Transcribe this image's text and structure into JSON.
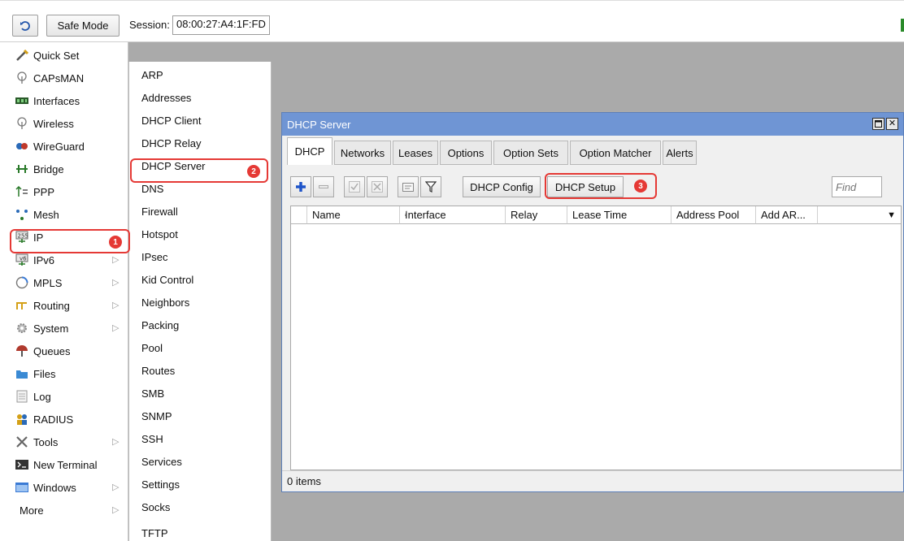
{
  "toolbar": {
    "safe_mode_label": "Safe Mode",
    "session_label": "Session:",
    "session_value": "08:00:27:A4:1F:FD"
  },
  "menu": {
    "items": [
      {
        "label": "Quick Set",
        "icon": "wand-icon"
      },
      {
        "label": "CAPsMAN",
        "icon": "antenna-icon"
      },
      {
        "label": "Interfaces",
        "icon": "interfaces-icon"
      },
      {
        "label": "Wireless",
        "icon": "wireless-icon"
      },
      {
        "label": "WireGuard",
        "icon": "wireguard-icon"
      },
      {
        "label": "Bridge",
        "icon": "bridge-icon"
      },
      {
        "label": "PPP",
        "icon": "ppp-icon"
      },
      {
        "label": "Mesh",
        "icon": "mesh-icon"
      },
      {
        "label": "IP",
        "icon": "ip-icon"
      },
      {
        "label": "IPv6",
        "icon": "ipv6-icon"
      },
      {
        "label": "MPLS",
        "icon": "mpls-icon"
      },
      {
        "label": "Routing",
        "icon": "routing-icon"
      },
      {
        "label": "System",
        "icon": "system-icon"
      },
      {
        "label": "Queues",
        "icon": "queues-icon"
      },
      {
        "label": "Files",
        "icon": "files-icon"
      },
      {
        "label": "Log",
        "icon": "log-icon"
      },
      {
        "label": "RADIUS",
        "icon": "radius-icon"
      },
      {
        "label": "Tools",
        "icon": "tools-icon"
      },
      {
        "label": "New Terminal",
        "icon": "terminal-icon"
      },
      {
        "label": "Windows",
        "icon": "windows-icon"
      },
      {
        "label": "More",
        "icon": ""
      }
    ]
  },
  "submenu": {
    "items": [
      "ARP",
      "Addresses",
      "DHCP Client",
      "DHCP Relay",
      "DHCP Server",
      "DNS",
      "Firewall",
      "Hotspot",
      "IPsec",
      "Kid Control",
      "Neighbors",
      "Packing",
      "Pool",
      "Routes",
      "SMB",
      "SNMP",
      "SSH",
      "Services",
      "Settings",
      "Socks",
      "TFTP"
    ]
  },
  "annotations": {
    "step1": "1",
    "step2": "2",
    "step3": "3"
  },
  "window": {
    "title": "DHCP Server",
    "tabs": [
      "DHCP",
      "Networks",
      "Leases",
      "Options",
      "Option Sets",
      "Option Matcher",
      "Alerts"
    ],
    "buttons": {
      "dhcp_config": "DHCP Config",
      "dhcp_setup": "DHCP Setup"
    },
    "find_placeholder": "Find",
    "columns": [
      "Name",
      "Interface",
      "Relay",
      "Lease Time",
      "Address Pool",
      "Add AR..."
    ],
    "status": "0 items"
  },
  "colors": {
    "highlight": "#e53935",
    "titlebar": "#6f95d4",
    "workspace": "#aaaaaa"
  }
}
